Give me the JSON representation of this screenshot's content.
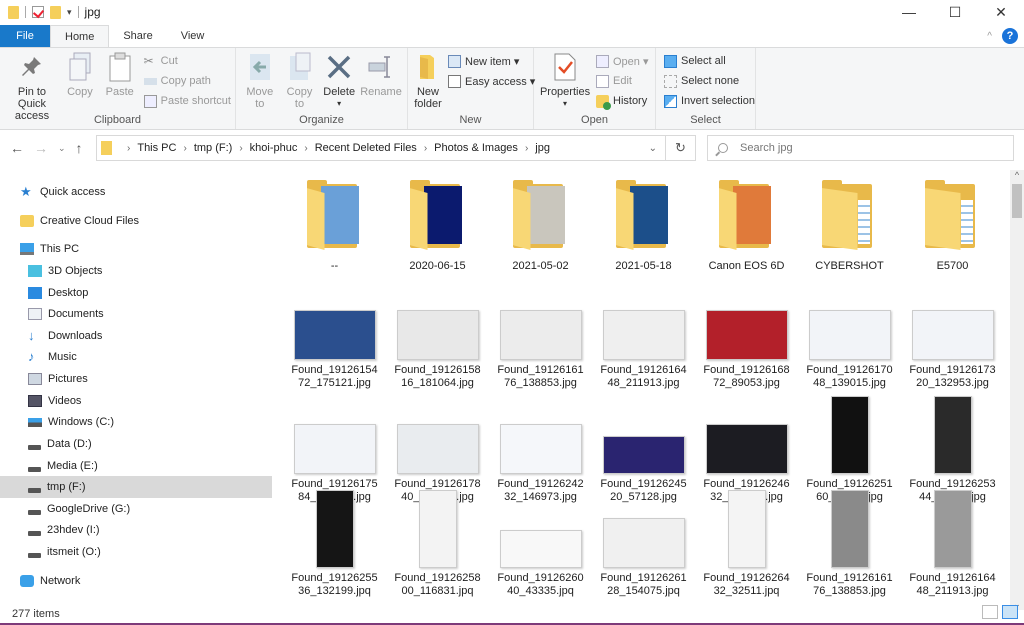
{
  "window": {
    "title": "jpg",
    "controls": {
      "minimize": "—",
      "maximize": "☐",
      "close": "✕"
    }
  },
  "ribbon_tabs": [
    {
      "label": "File"
    },
    {
      "label": "Home"
    },
    {
      "label": "Share"
    },
    {
      "label": "View"
    }
  ],
  "ribbon": {
    "clipboard": {
      "label": "Clipboard",
      "pin": "Pin to Quick access",
      "copy": "Copy",
      "paste": "Paste",
      "cut": "Cut",
      "copy_path": "Copy path",
      "paste_shortcut": "Paste shortcut"
    },
    "organize": {
      "label": "Organize",
      "move_to": "Move to",
      "copy_to": "Copy to",
      "delete": "Delete",
      "rename": "Rename"
    },
    "new": {
      "label": "New",
      "new_folder": "New folder",
      "new_item": "New item ▾",
      "easy_access": "Easy access ▾"
    },
    "open": {
      "label": "Open",
      "properties": "Properties",
      "open": "Open ▾",
      "edit": "Edit",
      "history": "History"
    },
    "select": {
      "label": "Select",
      "select_all": "Select all",
      "select_none": "Select none",
      "invert": "Invert selection"
    }
  },
  "address": {
    "breadcrumbs": [
      "This PC",
      "tmp (F:)",
      "khoi-phuc",
      "Recent Deleted Files",
      "Photos & Images",
      "jpg"
    ],
    "search_placeholder": "Search jpg"
  },
  "sidebar": {
    "items": [
      {
        "label": "Quick access",
        "icon": "star-icon"
      },
      {
        "label": "Creative Cloud Files",
        "icon": "creative-cloud-icon"
      },
      {
        "label": "This PC",
        "icon": "computer-icon"
      },
      {
        "label": "3D Objects",
        "icon": "cube-icon"
      },
      {
        "label": "Desktop",
        "icon": "desktop-icon"
      },
      {
        "label": "Documents",
        "icon": "document-icon"
      },
      {
        "label": "Downloads",
        "icon": "download-icon"
      },
      {
        "label": "Music",
        "icon": "music-icon"
      },
      {
        "label": "Pictures",
        "icon": "pictures-icon"
      },
      {
        "label": "Videos",
        "icon": "videos-icon"
      },
      {
        "label": "Windows (C:)",
        "icon": "windows-drive-icon"
      },
      {
        "label": "Data (D:)",
        "icon": "drive-icon"
      },
      {
        "label": "Media (E:)",
        "icon": "drive-icon"
      },
      {
        "label": "tmp (F:)",
        "icon": "drive-icon",
        "selected": true
      },
      {
        "label": "GoogleDrive (G:)",
        "icon": "drive-icon"
      },
      {
        "label": "23hdev (I:)",
        "icon": "drive-icon"
      },
      {
        "label": "itsmeit (O:)",
        "icon": "drive-icon"
      },
      {
        "label": "Network",
        "icon": "network-icon"
      }
    ]
  },
  "files": [
    {
      "name": "--",
      "type": "folder",
      "thumb": "#6aa0d8"
    },
    {
      "name": "2020-06-15",
      "type": "folder",
      "thumb": "#0b1a6e"
    },
    {
      "name": "2021-05-02",
      "type": "folder",
      "thumb": "#c9c6bd"
    },
    {
      "name": "2021-05-18",
      "type": "folder",
      "thumb": "#1c4f8a"
    },
    {
      "name": "Canon EOS 6D",
      "type": "folder",
      "thumb": "#e07a3a"
    },
    {
      "name": "CYBERSHOT",
      "type": "folder",
      "thumb": ""
    },
    {
      "name": "E5700",
      "type": "folder",
      "thumb": ""
    },
    {
      "name": "Found_1912615472_175121.jpg",
      "line1": "Found_19126154",
      "line2": "72_175121.jpg",
      "thumb": "#2b4f8e",
      "shape": "wide"
    },
    {
      "name": "Found_1912615816_181064.jpg",
      "line1": "Found_19126158",
      "line2": "16_181064.jpg",
      "thumb": "#e8e8e8",
      "shape": "wide"
    },
    {
      "name": "Found_1912616176_138853.jpg",
      "line1": "Found_19126161",
      "line2": "76_138853.jpg",
      "thumb": "#ececec",
      "shape": "wide"
    },
    {
      "name": "Found_1912616448_211913.jpg",
      "line1": "Found_19126164",
      "line2": "48_211913.jpg",
      "thumb": "#efefef",
      "shape": "wide"
    },
    {
      "name": "Found_1912616872_89053.jpg",
      "line1": "Found_19126168",
      "line2": "72_89053.jpg",
      "thumb": "#b3202a",
      "shape": "wide"
    },
    {
      "name": "Found_1912617048_139015.jpg",
      "line1": "Found_19126170",
      "line2": "48_139015.jpg",
      "thumb": "#f2f4f8",
      "shape": "wide"
    },
    {
      "name": "Found_1912617320_132953.jpg",
      "line1": "Found_19126173",
      "line2": "20_132953.jpg",
      "thumb": "#f2f4f8",
      "shape": "wide"
    },
    {
      "name": "Found_1912617584_128223.jpg",
      "line1": "Found_19126175",
      "line2": "84_128223.jpg",
      "thumb": "#f2f4f8",
      "shape": "wide"
    },
    {
      "name": "Found_1912617840_101472.jpg",
      "line1": "Found_19126178",
      "line2": "40_101472.jpg",
      "thumb": "#e9ecef",
      "shape": "wide"
    },
    {
      "name": "Found_1912624232_146973.jpg",
      "line1": "Found_19126242",
      "line2": "32_146973.jpg",
      "thumb": "#f5f7fa",
      "shape": "wide"
    },
    {
      "name": "Found_1912624520_57128.jpg",
      "line1": "Found_19126245",
      "line2": "20_57128.jpg",
      "thumb": "#2a2470",
      "shape": "short"
    },
    {
      "name": "Found_1912624632_268678.jpg",
      "line1": "Found_19126246",
      "line2": "32_268678.jpg",
      "thumb": "#1c1c22",
      "shape": "wide"
    },
    {
      "name": "Found_1912625160_93178.jpg",
      "line1": "Found_19126251",
      "line2": "60_93178.jpg",
      "thumb": "#111111",
      "shape": "tall"
    },
    {
      "name": "Found_1912625344_95216.jpg",
      "line1": "Found_19126253",
      "line2": "44_95216.jpg",
      "thumb": "#2a2a2a",
      "shape": "tall"
    },
    {
      "name": "Found_1912625536_132199.jpq",
      "line1": "Found_19126255",
      "line2": "36_132199.jpq",
      "thumb": "#151515",
      "shape": "tall"
    },
    {
      "name": "Found_1912625800_116831.jpq",
      "line1": "Found_19126258",
      "line2": "00_116831.jpq",
      "thumb": "#f3f3f3",
      "shape": "tall"
    },
    {
      "name": "Found_1912626040_43335.jpq",
      "line1": "Found_19126260",
      "line2": "40_43335.jpq",
      "thumb": "#f8f8f8",
      "shape": "short"
    },
    {
      "name": "Found_1912626128_154075.jpq",
      "line1": "Found_19126261",
      "line2": "28_154075.jpq",
      "thumb": "#f0f0f0",
      "shape": "wide"
    },
    {
      "name": "Found_1912626432_32511.jpq",
      "line1": "Found_19126264",
      "line2": "32_32511.jpq",
      "thumb": "#f4f4f4",
      "shape": "tall"
    },
    {
      "name": "Found_1912616176_138853.jpg",
      "line1": "Found_19126161",
      "line2": "76_138853.jpg",
      "thumb": "#8a8a8a",
      "shape": "tall"
    },
    {
      "name": "Found_1912616448_211913.jpg",
      "line1": "Found_19126164",
      "line2": "48_211913.jpg",
      "thumb": "#9a9a9a",
      "shape": "tall"
    }
  ],
  "status": {
    "item_count": "277 items"
  }
}
